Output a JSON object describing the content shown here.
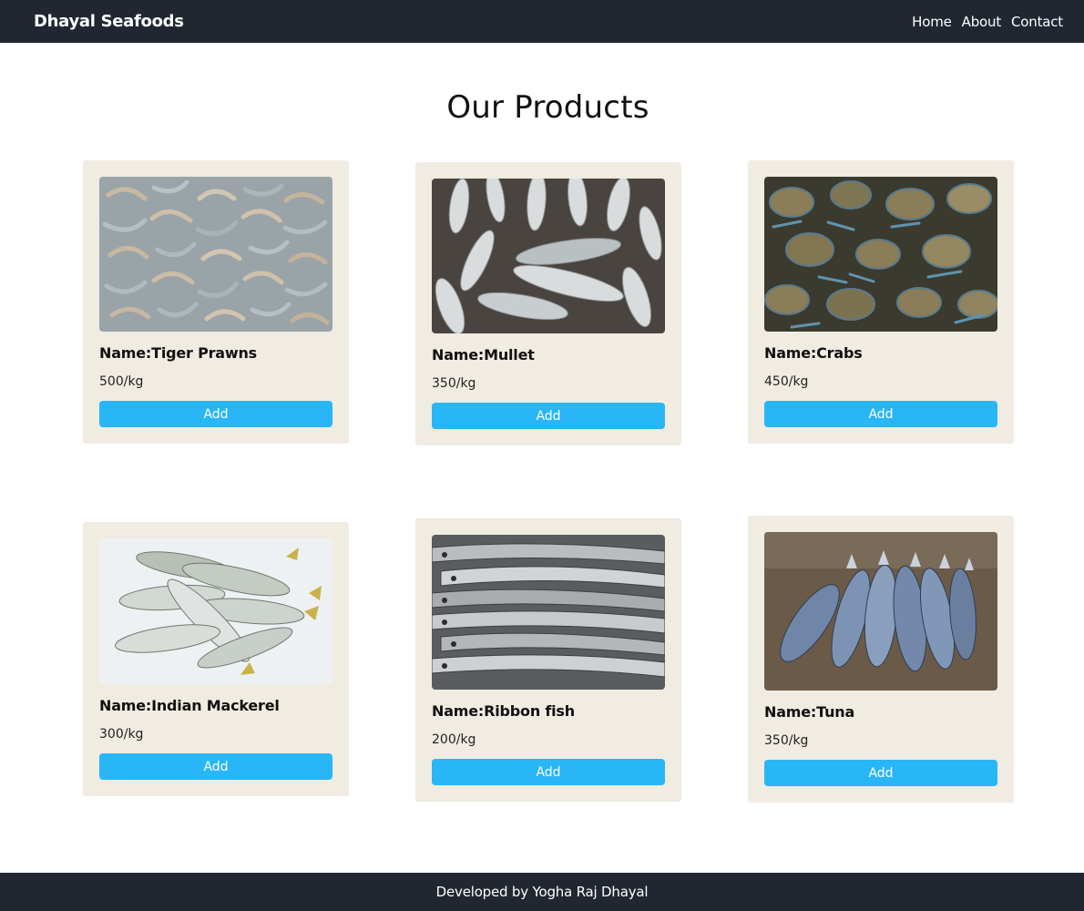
{
  "navbar": {
    "brand": "Dhayal Seafoods",
    "links": [
      "Home",
      "About",
      "Contact"
    ]
  },
  "page": {
    "heading": "Our Products"
  },
  "products": [
    {
      "name": "Name:Tiger Prawns",
      "price": "500/kg",
      "button": "Add",
      "image": "tiger-prawns-photo"
    },
    {
      "name": "Name:Mullet",
      "price": "350/kg",
      "button": "Add",
      "image": "mullet-photo"
    },
    {
      "name": "Name:Crabs",
      "price": "450/kg",
      "button": "Add",
      "image": "crabs-photo"
    },
    {
      "name": "Name:Indian Mackerel",
      "price": "300/kg",
      "button": "Add",
      "image": "indian-mackerel-photo"
    },
    {
      "name": "Name:Ribbon fish",
      "price": "200/kg",
      "button": "Add",
      "image": "ribbon-fish-photo"
    },
    {
      "name": "Name:Tuna",
      "price": "350/kg",
      "button": "Add",
      "image": "tuna-photo"
    }
  ],
  "footer": {
    "text": "Developed by Yogha Raj Dhayal"
  },
  "colors": {
    "navbar": "#212731",
    "card": "#f0ece2",
    "button": "#29b6f6"
  }
}
